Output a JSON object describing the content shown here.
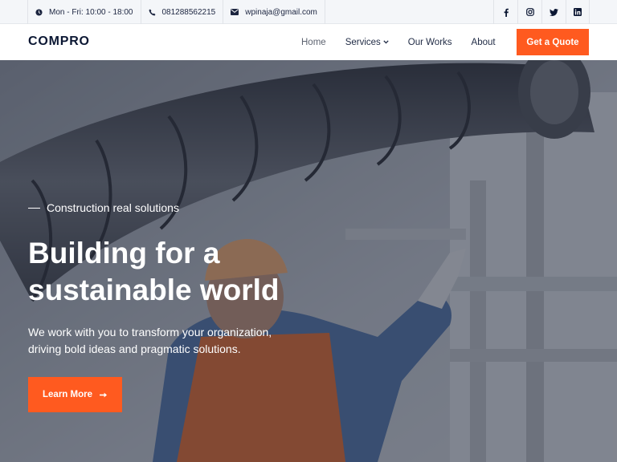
{
  "topbar": {
    "hours": "Mon - Fri: 10:00 - 18:00",
    "phone": "081288562215",
    "email": "wpinaja@gmail.com",
    "social": [
      "facebook-icon",
      "instagram-icon",
      "twitter-icon",
      "linkedin-icon"
    ]
  },
  "header": {
    "logo": "COMPRO",
    "nav": [
      {
        "label": "Home",
        "active": true
      },
      {
        "label": "Services",
        "dropdown": true
      },
      {
        "label": "Our Works"
      },
      {
        "label": "About"
      }
    ],
    "cta": "Get a Quote"
  },
  "hero": {
    "eyebrow": "Construction real solutions",
    "headline_line1": "Building for a",
    "headline_line2": "sustainable world",
    "description_line1": "We work with you to transform your organization,",
    "description_line2": "driving bold ideas and pragmatic solutions.",
    "button": "Learn More"
  },
  "colors": {
    "accent": "#ff5a1f",
    "dark": "#0b1733",
    "topbar_bg": "#f4f6f9"
  }
}
